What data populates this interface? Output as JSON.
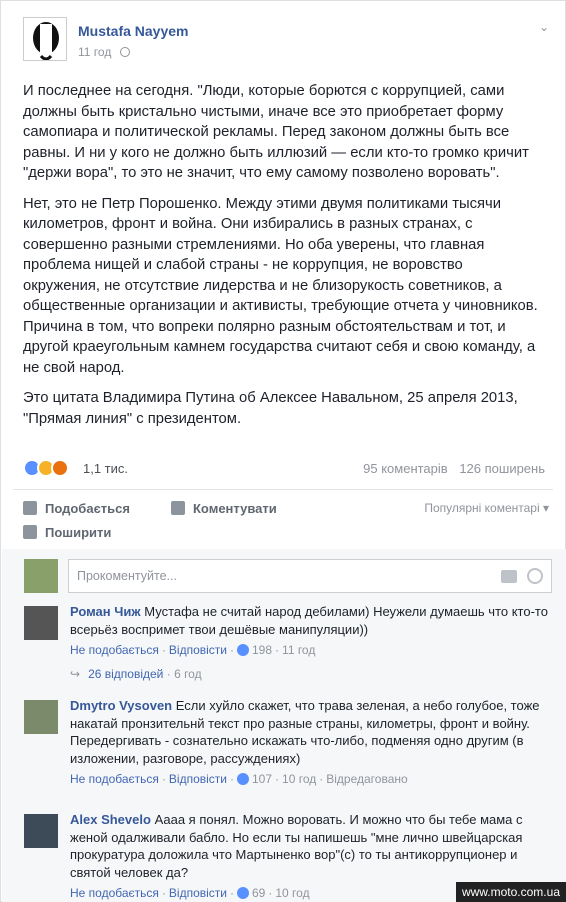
{
  "post": {
    "author": "Mustafa Nayyem",
    "time": "11 год",
    "paragraphs": [
      "И последнее на сегодня. \"Люди, которые борются с коррупцией, сами должны быть кристально чистыми, иначе все это приобретает форму самопиара и политической рекламы. Перед законом должны быть все равны. И ни у кого не должно быть иллюзий — если кто-то громко кричит \"держи вора\", то это не значит, что ему самому позволено воровать\".",
      "Нет, это не Петр Порошенко. Между этими двумя политиками тысячи километров, фронт и война. Они избирались в разных странах, с совершенно разными стремлениями. Но оба уверены, что главная проблема нищей и слабой страны - не коррупция, не воровство окружения, не отсутствие лидерства и не близорукость советников, а общественные организации и активисты, требующие отчета у чиновников. Причина в том, что вопреки полярно разным обстоятельствам и тот, и другой краеугольным камнем государства считают себя и свою команду, а не свой народ.",
      "Это цитата Владимира Путина об Алексее Навальном, 25 апреля 2013, \"Прямая линия\" с президентом."
    ],
    "reaction_count": "1,1 тис.",
    "comments_count": "95 коментарів",
    "shares_count": "126 поширень"
  },
  "actions": {
    "like": "Подобається",
    "comment": "Коментувати",
    "share": "Поширити",
    "sort": "Популярні коментарі ▾"
  },
  "composer": {
    "placeholder": "Прокоментуйте..."
  },
  "comments": [
    {
      "name": "Роман Чиж",
      "text": "Мустафа не считай народ дебилами) Неужели думаешь что кто-то всерьёз воспримет твои дешёвые манипуляции))",
      "like": "Не подобається",
      "reply": "Відповісти",
      "likes": "198",
      "time": "11 год"
    },
    {
      "name": "Dmytro Vysoven",
      "text": "Если хуйло скажет, что трава зеленая, а небо голубое, тоже накатай пронзительнй текст про разные страны, километры, фронт и войну.",
      "text2": "Передергивать - сознательно искажать что-либо, подменяя одно другим (в изложении, разговоре, рассуждениях)",
      "like": "Не подобається",
      "reply": "Відповісти",
      "likes": "107",
      "time": "10 год",
      "edited": "Відредаговано"
    },
    {
      "name": "Alex Shevelo",
      "text": "Аааа я понял. Можно воровать. И можно что бы тебе мама с женой одалживали бабло. Но если ты напишешь \"мне лично швейцарская прокуратура доложила что Мартыненко вор\"(с) то ты антикоррупционер и святой человек да?",
      "like": "Не подобається",
      "reply": "Відповісти",
      "likes": "69",
      "time": "10 год"
    }
  ],
  "replies": {
    "count": "26 відповідей",
    "time": "6 год"
  },
  "watermark": "www.moto.com.ua"
}
